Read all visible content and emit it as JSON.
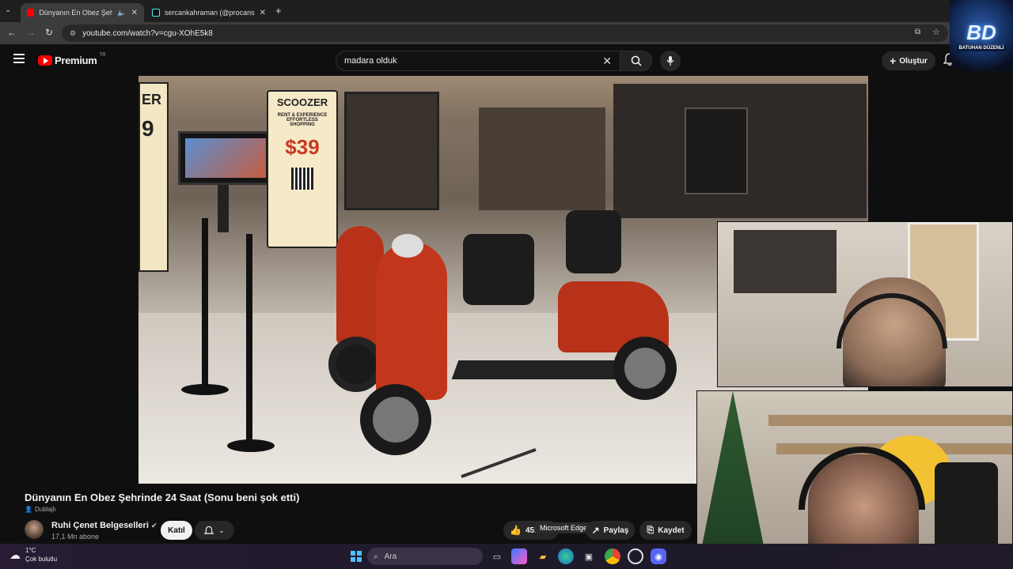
{
  "browser": {
    "tabs": [
      {
        "title": "Dünyanın En Obez Şehrinde",
        "favicon_color": "#ff0000",
        "active": true
      },
      {
        "title": "sercankahraman (@procanserc",
        "favicon_color": "#111111",
        "active": false
      }
    ],
    "url": "youtube.com/watch?v=cgu-XOhE5k8",
    "new_tab_icon": "+"
  },
  "youtube": {
    "logo_label": "Premium",
    "region": "TR",
    "search_value": "madara olduk",
    "create_label": "Oluştur"
  },
  "video": {
    "title": "Dünyanın En Obez Şehrinde 24 Saat (Sonu beni şok etti)",
    "badge": "Dublajlı",
    "channel_name": "Ruhi Çenet Belgeselleri",
    "subscribers": "17,1 Mn abone",
    "join_label": "Katıl",
    "like_count": "451",
    "share_label": "Paylaş",
    "save_label": "Kaydet",
    "tooltip": "Microsoft Edge",
    "sign_brand": "SCOOZER",
    "sign_text1": "RENT & EXPERIENCE",
    "sign_text2": "EFFORTLESS",
    "sign_text3": "SHOPPING",
    "sign_price": "$39"
  },
  "taskbar": {
    "temperature": "1°C",
    "weather": "Çok bulutlu",
    "search_label": "Ara"
  },
  "overlay": {
    "logo_text": "BD",
    "logo_sub": "BATUHAN DÜZENLİ"
  },
  "colors": {
    "yt_red": "#ff0000",
    "bg": "#0f0f0f",
    "scooter_red": "#c2371c"
  }
}
